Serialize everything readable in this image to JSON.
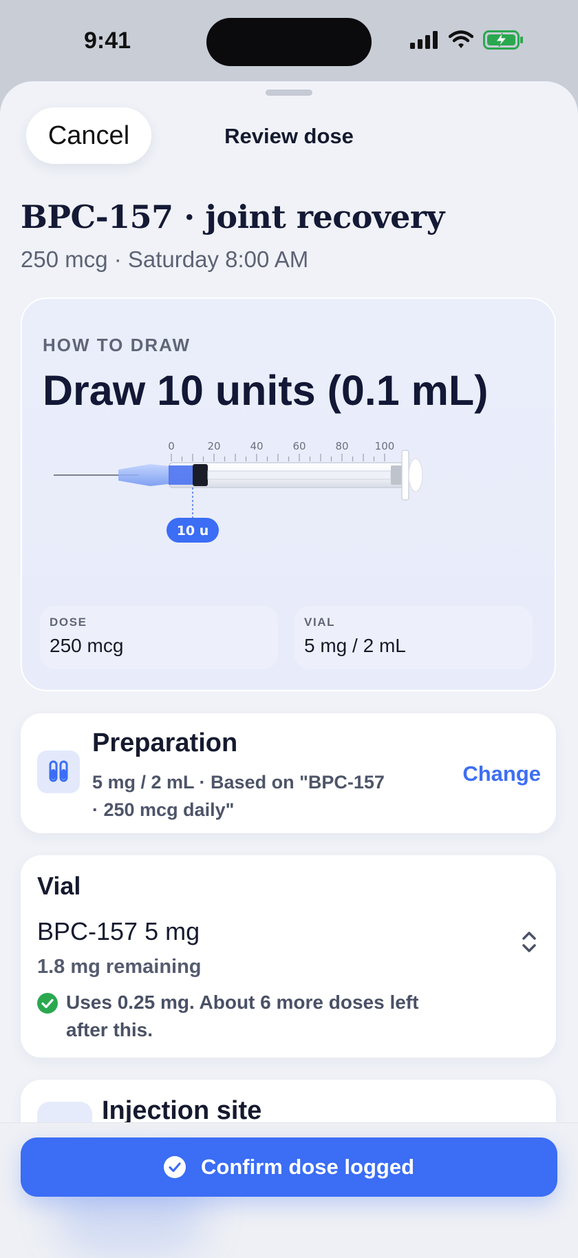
{
  "status": {
    "time": "9:41"
  },
  "nav": {
    "cancel_label": "Cancel",
    "title": "Review dose"
  },
  "header": {
    "title": "BPC-157 · joint recovery",
    "subtitle": "250 mcg · Saturday 8:00 AM"
  },
  "draw_card": {
    "kicker": "HOW TO DRAW",
    "headline": "Draw 10 units (0.1 mL)",
    "syringe_ticks": [
      "0",
      "20",
      "40",
      "60",
      "80",
      "100"
    ],
    "draw_level_units": 10,
    "marker_label": "10 u",
    "dose_label": "DOSE",
    "dose_value": "250 mcg",
    "vial_label": "VIAL",
    "vial_value": "5 mg / 2 mL"
  },
  "preparation": {
    "title": "Preparation",
    "description": "5 mg / 2 mL · Based on \"BPC-157 · 250 mcg daily\"",
    "change_label": "Change",
    "icon": "test-tubes-icon"
  },
  "vial": {
    "heading": "Vial",
    "name": "BPC-157 5 mg",
    "remaining": "1.8 mg remaining",
    "note": "Uses 0.25 mg. About 6 more doses left after this."
  },
  "injection_site": {
    "title": "Injection site"
  },
  "footer": {
    "confirm_label": "Confirm dose logged"
  },
  "colors": {
    "accent": "#3b6df5",
    "success": "#2aa84f",
    "background": "#f0f2f8"
  }
}
